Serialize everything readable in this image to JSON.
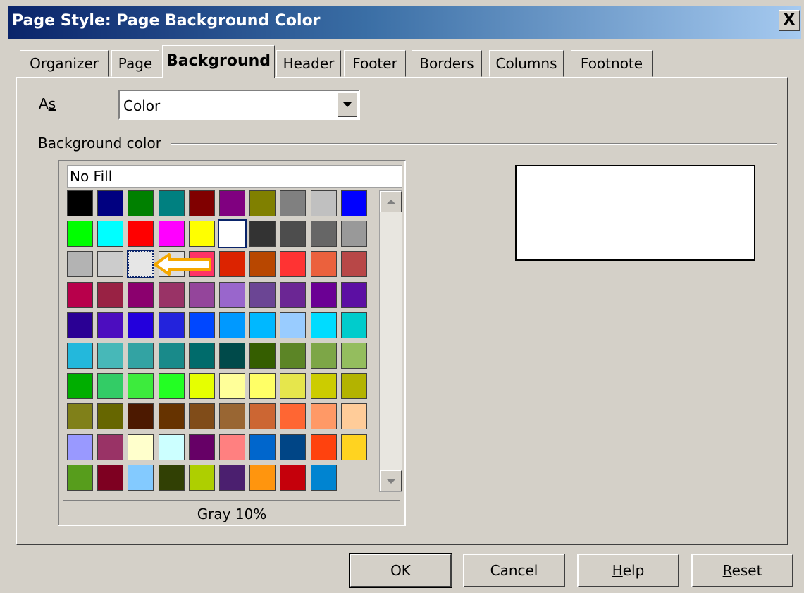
{
  "window": {
    "title": "Page Style: Page Background Color",
    "close_label": "X"
  },
  "tabs": [
    {
      "label": "Organizer"
    },
    {
      "label": "Page"
    },
    {
      "label": "Background",
      "active": true
    },
    {
      "label": "Header"
    },
    {
      "label": "Footer"
    },
    {
      "label": "Borders"
    },
    {
      "label": "Columns"
    },
    {
      "label": "Footnote"
    }
  ],
  "as_field": {
    "label_prefix": "A",
    "label_mnemonic": "s",
    "value": "Color"
  },
  "section": {
    "label": "Background color"
  },
  "palette": {
    "no_fill": "No Fill",
    "selected_name": "Gray 10%",
    "colors": [
      [
        "#000000",
        "#000080",
        "#008000",
        "#008080",
        "#800000",
        "#800080",
        "#808000",
        "#808080",
        "#c0c0c0",
        "#0000ff"
      ],
      [
        "#00ff00",
        "#00ffff",
        "#ff0000",
        "#ff00ff",
        "#ffff00",
        "#ffffff",
        "#333333",
        "#4d4d4d",
        "#666666",
        "#999999"
      ],
      [
        "#b3b3b3",
        "#cccccc",
        "#e6e6e6",
        "#dddddd",
        "#ff3366",
        "#dc2300",
        "#b84700",
        "#ff3333",
        "#eb613d",
        "#b84747"
      ],
      [
        "#b8004b",
        "#992244",
        "#8b006e",
        "#993366",
        "#94459b",
        "#9966cc",
        "#6b4594",
        "#6b2694",
        "#6b0094",
        "#5c0fa3"
      ],
      [
        "#2a0094",
        "#4c0dbf",
        "#2300dc",
        "#2323dc",
        "#0047ff",
        "#0099ff",
        "#00b8ff",
        "#99ccff",
        "#00dcff",
        "#00cccc"
      ],
      [
        "#23b8dc",
        "#47b8b8",
        "#33a3a3",
        "#198a8a",
        "#006b6b",
        "#004a4a",
        "#355e00",
        "#5c8526",
        "#7da647",
        "#94bd5e"
      ],
      [
        "#00ae00",
        "#33cc66",
        "#3deb3d",
        "#23ff23",
        "#e6ff00",
        "#ffff99",
        "#ffff66",
        "#e6e64c",
        "#cccc00",
        "#b3b300"
      ],
      [
        "#808019",
        "#666600",
        "#4c1900",
        "#663300",
        "#804c19",
        "#996633",
        "#cc6633",
        "#ff6633",
        "#ff9966",
        "#ffcc99"
      ],
      [
        "#9999ff",
        "#993366",
        "#ffffcc",
        "#ccffff",
        "#660066",
        "#ff8080",
        "#0066cc",
        "#004586",
        "#ff420e",
        "#ffd320"
      ],
      [
        "#579d1c",
        "#7e0021",
        "#83caff",
        "#314004",
        "#aecf00",
        "#4b1f6f",
        "#ff950e",
        "#c5000b",
        "#0084d1",
        ""
      ]
    ],
    "selected_cell": [
      1,
      5
    ],
    "focused_cell": [
      2,
      2
    ]
  },
  "preview": {
    "color": "#ffffff"
  },
  "buttons": {
    "ok": "OK",
    "cancel": "Cancel",
    "help_mnemonic": "H",
    "help_rest": "elp",
    "reset_mnemonic": "R",
    "reset_rest": "eset"
  }
}
